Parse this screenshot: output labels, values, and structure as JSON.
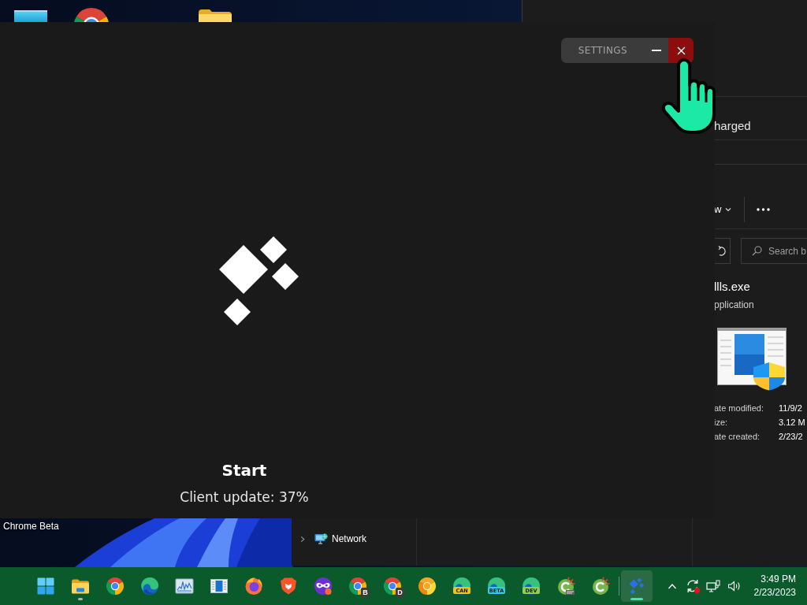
{
  "desktop": {
    "icons": [
      {
        "kind": "tile"
      },
      {
        "kind": "browser"
      },
      {
        "kind": "folder"
      }
    ],
    "icon_label": "Chrome Beta"
  },
  "launcher": {
    "settings_label": "SETTINGS",
    "title": "Start",
    "status": "Client update: 37%"
  },
  "background_window": {
    "text": "harged"
  },
  "explorer": {
    "toolbar_button": "w",
    "search": {
      "placeholder": "Search b"
    },
    "file_name": "llls.exe",
    "file_type": "pplication",
    "details": [
      {
        "label": "ate modified:",
        "value": "11/9/2"
      },
      {
        "label": "ize:",
        "value": "3.12 M"
      },
      {
        "label": "ate created:",
        "value": "2/23/2"
      }
    ],
    "nav_items": [
      {
        "label": "Network",
        "expanded": false
      }
    ]
  },
  "taskbar": {
    "pinned": [
      {
        "kind": "start",
        "running": false,
        "selected": false
      },
      {
        "kind": "folder",
        "running": true,
        "selected": false
      },
      {
        "kind": "chrome",
        "running": false,
        "selected": false
      },
      {
        "kind": "edge",
        "running": false,
        "selected": false
      },
      {
        "kind": "monitor",
        "running": false,
        "selected": false
      },
      {
        "kind": "window",
        "running": false,
        "selected": false
      },
      {
        "kind": "firefox",
        "running": false,
        "selected": false
      },
      {
        "kind": "brave",
        "running": false,
        "selected": false
      },
      {
        "kind": "mask",
        "running": false,
        "selected": false
      },
      {
        "kind": "chrome",
        "badge": "B",
        "color": "#3c3c3c",
        "running": false,
        "selected": false
      },
      {
        "kind": "chrome",
        "badge": "D",
        "color": "#3c3c3c",
        "running": false,
        "selected": false
      },
      {
        "kind": "canary",
        "running": false,
        "selected": false
      },
      {
        "kind": "edge",
        "badge": "CAN",
        "color": "#f2c21b",
        "running": false,
        "selected": false
      },
      {
        "kind": "edge",
        "badge": "BETA",
        "color": "#3fc8e4",
        "running": false,
        "selected": false
      },
      {
        "kind": "edge",
        "badge": "DEV",
        "color": "#8fd14f",
        "running": false,
        "selected": false
      },
      {
        "kind": "cleanertag",
        "running": false,
        "selected": false
      },
      {
        "kind": "cleaner",
        "running": false,
        "selected": false
      }
    ],
    "open": [
      {
        "kind": "launcher",
        "running": true,
        "selected": true
      }
    ],
    "tray": [
      {
        "kind": "chevron"
      },
      {
        "kind": "sync"
      },
      {
        "kind": "network"
      },
      {
        "kind": "volume"
      }
    ],
    "time": "3:49 PM",
    "date": "2/23/2023"
  }
}
